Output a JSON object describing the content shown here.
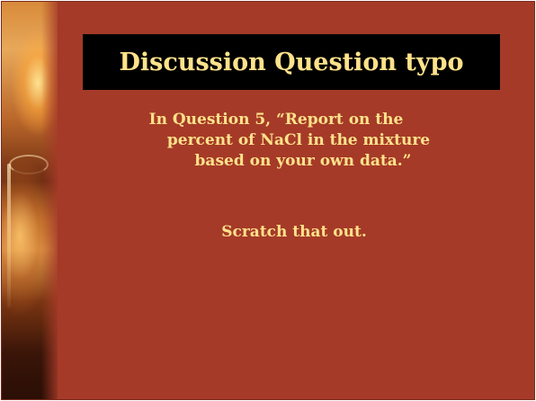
{
  "slide": {
    "title": "Discussion Question typo",
    "body_lines": [
      "In Question 5, “Report on the",
      "percent of NaCl in the mixture",
      "based on your own data.”"
    ],
    "note": "Scratch that out."
  },
  "colors": {
    "background": "#a53a28",
    "title_box": "#000000",
    "text": "#ffe28a"
  },
  "icons": {
    "side_image": "beaker-photo"
  }
}
